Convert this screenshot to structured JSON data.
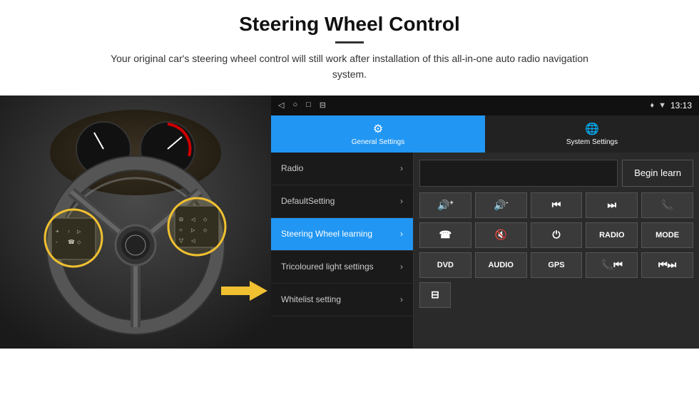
{
  "header": {
    "title": "Steering Wheel Control",
    "subtitle": "Your original car's steering wheel control will still work after installation of this all-in-one auto radio navigation system."
  },
  "status_bar": {
    "icons": [
      "◁",
      "○",
      "□",
      "⊟"
    ],
    "right_icons": [
      "♦",
      "▼"
    ],
    "time": "13:13"
  },
  "tabs": [
    {
      "label": "General Settings",
      "icon": "⚙",
      "active": true
    },
    {
      "label": "System Settings",
      "icon": "🌐",
      "active": false
    }
  ],
  "menu_items": [
    {
      "label": "Radio",
      "active": false
    },
    {
      "label": "DefaultSetting",
      "active": false
    },
    {
      "label": "Steering Wheel learning",
      "active": true
    },
    {
      "label": "Tricoloured light settings",
      "active": false
    },
    {
      "label": "Whitelist setting",
      "active": false
    }
  ],
  "begin_learn_button": "Begin learn",
  "control_buttons": [
    [
      {
        "label": "🔊+",
        "type": "icon"
      },
      {
        "label": "🔊-",
        "type": "icon"
      },
      {
        "label": "⏮",
        "type": "icon"
      },
      {
        "label": "⏭",
        "type": "icon"
      },
      {
        "label": "📞",
        "type": "icon"
      }
    ],
    [
      {
        "label": "☎",
        "type": "icon"
      },
      {
        "label": "🔇",
        "type": "icon"
      },
      {
        "label": "⏻",
        "type": "icon"
      },
      {
        "label": "RADIO",
        "type": "text"
      },
      {
        "label": "MODE",
        "type": "text"
      }
    ],
    [
      {
        "label": "DVD",
        "type": "text"
      },
      {
        "label": "AUDIO",
        "type": "text"
      },
      {
        "label": "GPS",
        "type": "text"
      },
      {
        "label": "📞⏮",
        "type": "icon"
      },
      {
        "label": "⏮⏭",
        "type": "icon"
      }
    ],
    [
      {
        "label": "⊟",
        "type": "icon"
      }
    ]
  ]
}
